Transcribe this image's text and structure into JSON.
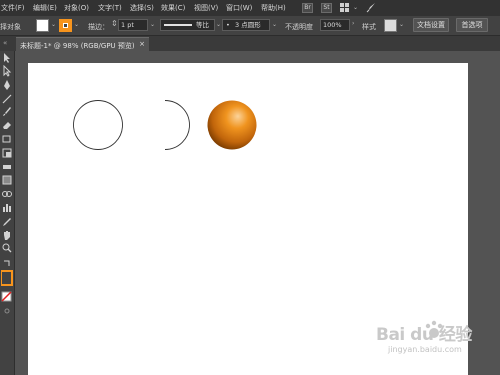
{
  "menu": {
    "items": [
      "文件(F)",
      "编辑(E)",
      "对象(O)",
      "文字(T)",
      "选择(S)",
      "效果(C)",
      "视图(V)",
      "窗口(W)",
      "帮助(H)"
    ],
    "bridge_label": "Br",
    "stock_label": "St"
  },
  "control_bar": {
    "object_label": "未选择对象",
    "stroke_label": "描边：",
    "stroke_width": "1 pt",
    "stroke_profile": "等比",
    "brush_label": "3 点圆形",
    "opacity_label": "不透明度",
    "opacity_value": "100%",
    "style_label": "样式",
    "doc_setup_button": "文档设置",
    "preferences_button": "首选项",
    "fill_color": "#ffffff",
    "stroke_color": "#f7941d"
  },
  "document_tab": {
    "title": "未标题-1* @ 98% (RGB/GPU 预览)",
    "close_glyph": "×"
  },
  "artwork": {
    "circle_stroke": "#333333",
    "sphere_colors": [
      "#fbd39a",
      "#f0941f",
      "#c1650b",
      "#7a3b00"
    ]
  },
  "watermark": {
    "text": "Bai du 经验",
    "url": "jingyan.baidu.com"
  }
}
